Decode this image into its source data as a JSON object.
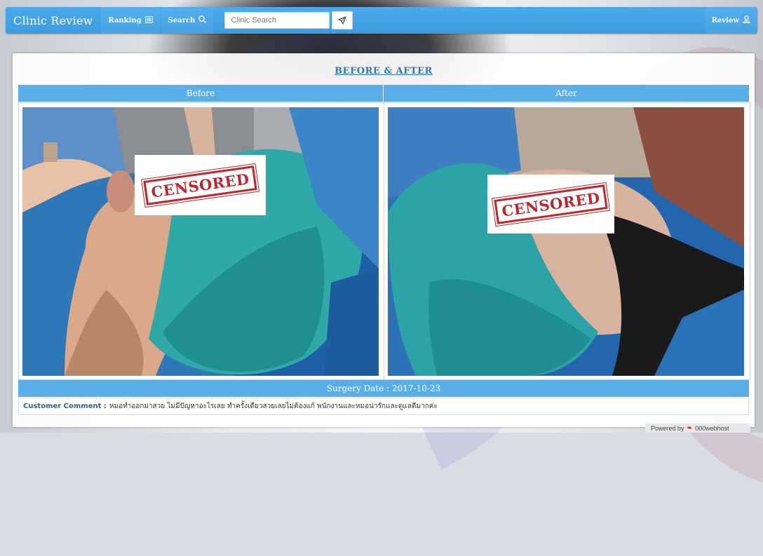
{
  "navbar": {
    "brand": "Clinic Review",
    "ranking_label": "Ranking",
    "search_label": "Search",
    "search_placeholder": "Clinic Search",
    "review_label": "Review"
  },
  "content": {
    "title": "BEFORE & AFTER",
    "before_label": "Before",
    "after_label": "After",
    "censor_text": "CENSORED",
    "surgery_date": "Surgery Date : 2017-10-23",
    "comment_label": "Customer Comment :",
    "comment_text": "หมอทำออกมาสวย ไม่มีปัญหาอะไรเลย ทำครั้งเดียวสวยเลยไม่ต้องแก้ พนักงานและหมอน่ารักและดูแลดีมากค่ะ"
  },
  "footer": {
    "powered_by": "Powered by",
    "host": "000webhost"
  },
  "colors": {
    "navbar": "#3b9ce0",
    "header_bar": "#5aaee8",
    "title": "#2f78b8",
    "stamp": "#c4232a"
  }
}
